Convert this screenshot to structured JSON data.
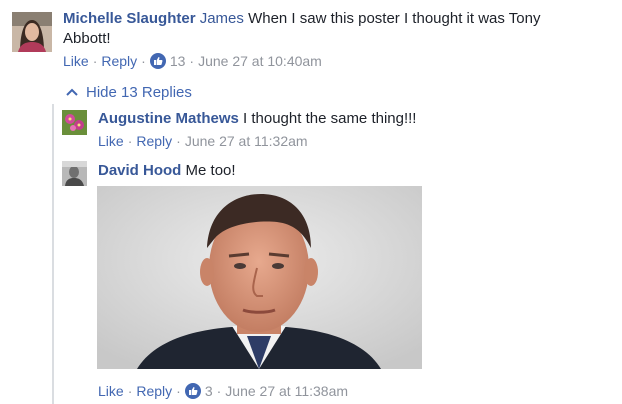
{
  "comment_main": {
    "author": "Michelle Slaughter",
    "mention": "James",
    "text_line1": "When I saw this poster I thought it was Tony",
    "text_line2": "Abbott!",
    "like_label": "Like",
    "reply_label": "Reply",
    "like_count": "13",
    "timestamp": "June 27 at 10:40am"
  },
  "replies_toggle": {
    "label": "Hide 13 Replies"
  },
  "reply_1": {
    "author": "Augustine Mathews",
    "text": "I thought the same thing!!!",
    "like_label": "Like",
    "reply_label": "Reply",
    "timestamp": "June 27 at 11:32am"
  },
  "reply_2": {
    "author": "David Hood",
    "text": "Me too!",
    "like_label": "Like",
    "reply_label": "Reply",
    "like_count": "3",
    "timestamp": "June 27 at 11:38am"
  },
  "colors": {
    "link_blue": "#4267b2",
    "author_blue": "#385898",
    "meta_grey": "#90949c",
    "thread_line": "#dadde1"
  },
  "icons": [
    "like-icon",
    "chevron-up-icon"
  ]
}
